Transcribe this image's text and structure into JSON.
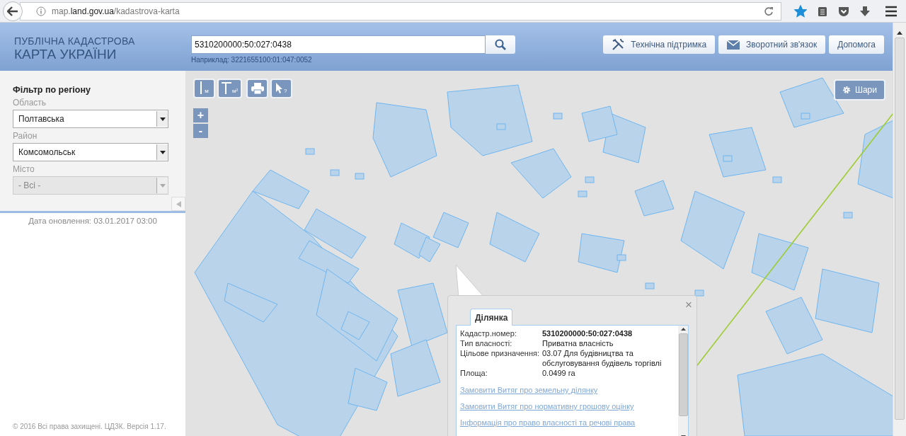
{
  "browser": {
    "url": {
      "subdomain": "map.",
      "domain": "land.gov.ua",
      "path": "/kadastrova-karta"
    },
    "bookmarked": true
  },
  "header": {
    "logo": [
      "ПУБЛІЧНА КАДАСТРОВА",
      "КАРТА УКРАЇНИ"
    ],
    "search": {
      "value": "5310200000:50:027:0438"
    },
    "hint": "Наприклад: 3221655100:01:047:0052",
    "buttons": [
      {
        "kind": "tools",
        "label": "Технічна підтримка"
      },
      {
        "kind": "mail",
        "label": "Зворотний зв'язок"
      },
      {
        "kind": "none",
        "label": "Допомога"
      }
    ]
  },
  "sidebar": {
    "title": "Фільтр по регіону",
    "fields": [
      {
        "label": "Область",
        "value": "Полтавська",
        "disabled": false
      },
      {
        "label": "Район",
        "value": "Комсомольськ",
        "disabled": false
      },
      {
        "label": "Місто",
        "value": "- Всі -",
        "disabled": true
      }
    ],
    "updated": "Дата оновлення: 03.01.2017 03:00",
    "footer": "© 2016 Всі права захищені. ЦДЗК. Версія 1.17."
  },
  "map": {
    "tools": [
      {
        "kind": "distance",
        "label": "м"
      },
      {
        "kind": "area",
        "label": "м²"
      },
      {
        "kind": "print"
      },
      {
        "kind": "identify",
        "label": "?"
      }
    ],
    "zoom": [
      "+",
      "-"
    ],
    "layers": "Шари",
    "popup": {
      "tabs": [
        {
          "label": "Ділянка",
          "selected": true
        }
      ],
      "close": "×",
      "rows": [
        {
          "label": "Кадастр.номер:",
          "value": "5310200000:50:027:0438",
          "bold": true
        },
        {
          "label": "Тип власності:",
          "value": "Приватна власність",
          "bold": false
        },
        {
          "label": "Цільове призначення:",
          "value": "03.07 Для будівництва та обслуговування будівель торгівлі",
          "bold": false
        },
        {
          "label": "Площа:",
          "value": "0.0499 га",
          "bold": false
        }
      ],
      "links": [
        "Замовити Витяг про земельну ділянку",
        "Замовити Витяг про нормативну грошову оцінку",
        "Інформація про право власності та речові права"
      ]
    }
  }
}
